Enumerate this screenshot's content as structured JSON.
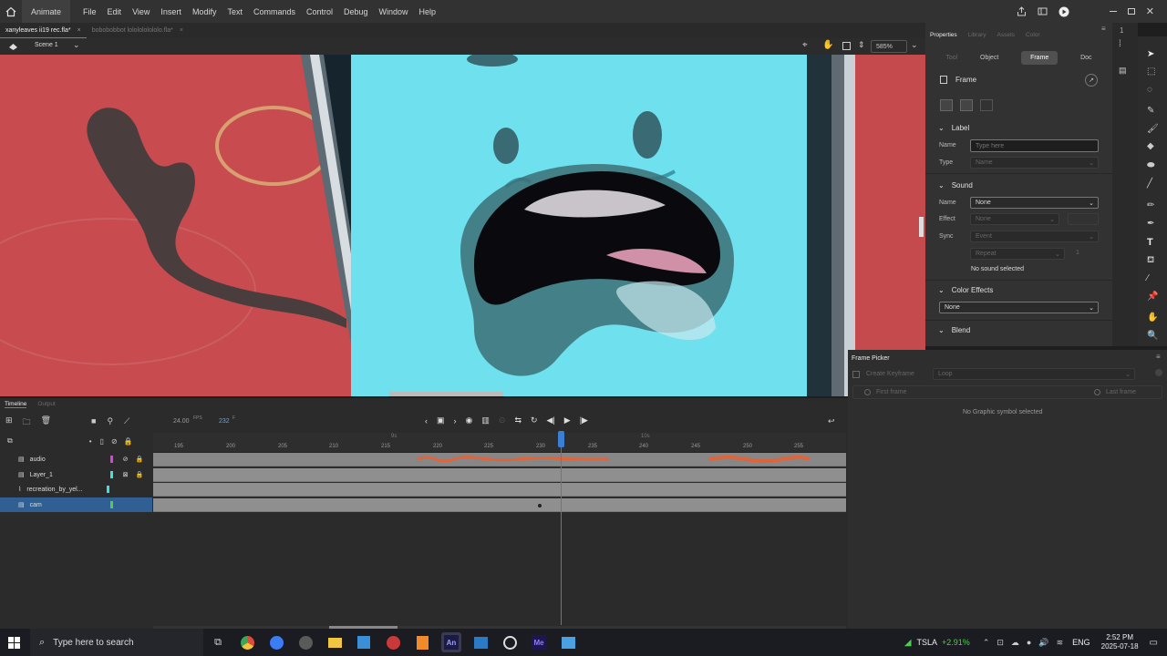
{
  "menubar": {
    "home_icon": "home-icon",
    "app_label": "Animate",
    "items": [
      "File",
      "Edit",
      "View",
      "Insert",
      "Modify",
      "Text",
      "Commands",
      "Control",
      "Debug",
      "Window",
      "Help"
    ]
  },
  "docs": {
    "tabs": [
      {
        "label": "xanyleaves ii19 rec.fla*",
        "active": true
      },
      {
        "label": "bobobobbot lololololololo.fla*",
        "active": false
      }
    ]
  },
  "scene": {
    "label": "Scene 1",
    "zoom": "585%"
  },
  "properties": {
    "tabs": [
      "Properties",
      "Library",
      "Assets",
      "Color"
    ],
    "subtabs": [
      "Tool",
      "Object",
      "Frame",
      "Doc"
    ],
    "frame_title": "Frame",
    "label_section": "Label",
    "name_label": "Name",
    "name_placeholder": "Type here",
    "type_label": "Type",
    "type_value": "Name",
    "sound_section": "Sound",
    "sound_name_label": "Name",
    "sound_name_value": "None",
    "effect_label": "Effect",
    "effect_value": "None",
    "sync_label": "Sync",
    "sync_value": "Event",
    "repeat_value": "Repeat",
    "repeat_count": "1",
    "no_sound": "No sound selected",
    "color_effects_section": "Color Effects",
    "color_effects_value": "None",
    "blend_section": "Blend"
  },
  "frame_picker": {
    "title": "Frame Picker",
    "create_keyframe": "Create Keyframe",
    "loop": "Loop",
    "first_frame": "First frame",
    "last_frame": "Last frame",
    "empty": "No Graphic symbol selected"
  },
  "timeline": {
    "tabs": [
      "Timeline",
      "Output"
    ],
    "fps": "24.00",
    "fps_unit": "FPS",
    "frame": "232",
    "frame_unit": "F",
    "ruler": [
      "195",
      "200",
      "205",
      "210",
      "215",
      "220",
      "225",
      "230",
      "235",
      "240",
      "245",
      "250",
      "255"
    ],
    "sec_marks": [
      "9s",
      "10s"
    ],
    "layers": [
      {
        "name": "audio",
        "color": "#e040e0",
        "selected": false
      },
      {
        "name": "Layer_1",
        "color": "#40e0e0",
        "selected": false
      },
      {
        "name": "recreation_by_yel...",
        "color": "#40e0e0",
        "selected": false
      },
      {
        "name": "cam",
        "color": "#4ccf4c",
        "selected": true
      }
    ]
  },
  "taskbar": {
    "search_placeholder": "Type here to search",
    "ticker": "TSLA",
    "ticker_change": "+2.91%",
    "lang": "ENG",
    "time": "2:52 PM",
    "date": "2025-07-18"
  },
  "colors": {
    "accent": "#3b8ed8",
    "stage_red": "#c44a4e",
    "stage_cyan": "#6ee0ee",
    "timeline_grey": "#8f8f8f"
  }
}
